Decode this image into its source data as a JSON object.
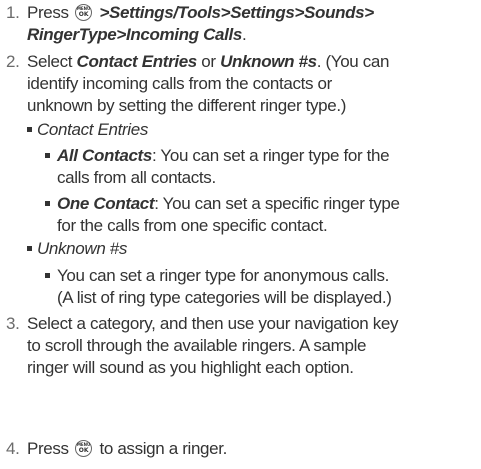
{
  "steps": [
    {
      "num": "1.",
      "line1_prefix": "Press",
      "ok_top": "MENU",
      "ok_bottom": "OK",
      "line1_path": " >Settings/Tools>Settings>Sounds>",
      "line2_path": "RingerType>Incoming Calls",
      "line2_end": "."
    },
    {
      "num": "2.",
      "t1": "Select ",
      "opt1": "Contact Entries",
      "t2": " or ",
      "opt2": "Unknown #s",
      "t3": ". (You can",
      "line2": "identify incoming calls from the contacts or",
      "line3": "unknown by setting the different ringer type.)"
    },
    {
      "num": "3.",
      "line1": "Select a category, and then use your navigation key",
      "line2": "to scroll through the available ringers. A sample",
      "line3": "ringer will sound as you highlight each option."
    },
    {
      "num": "4.",
      "prefix": "Press",
      "ok_top": "MENU",
      "ok_bottom": "OK",
      "suffix": " to assign a ringer."
    }
  ],
  "contact_entries": {
    "heading": "Contact Entries",
    "all_contacts": {
      "label": "All Contacts",
      "line1_rest": ": You can set a ringer type for the",
      "line2": "calls  from all contacts."
    },
    "one_contact": {
      "label": "One Contact",
      "line1_rest": ": You can set a specific ringer type",
      "line2": "for the calls from one specific contact."
    }
  },
  "unknown": {
    "heading": "Unknown #s",
    "line1": "You can set a ringer type for anonymous calls.",
    "line2": "(A list of ring type categories will be displayed.)"
  }
}
